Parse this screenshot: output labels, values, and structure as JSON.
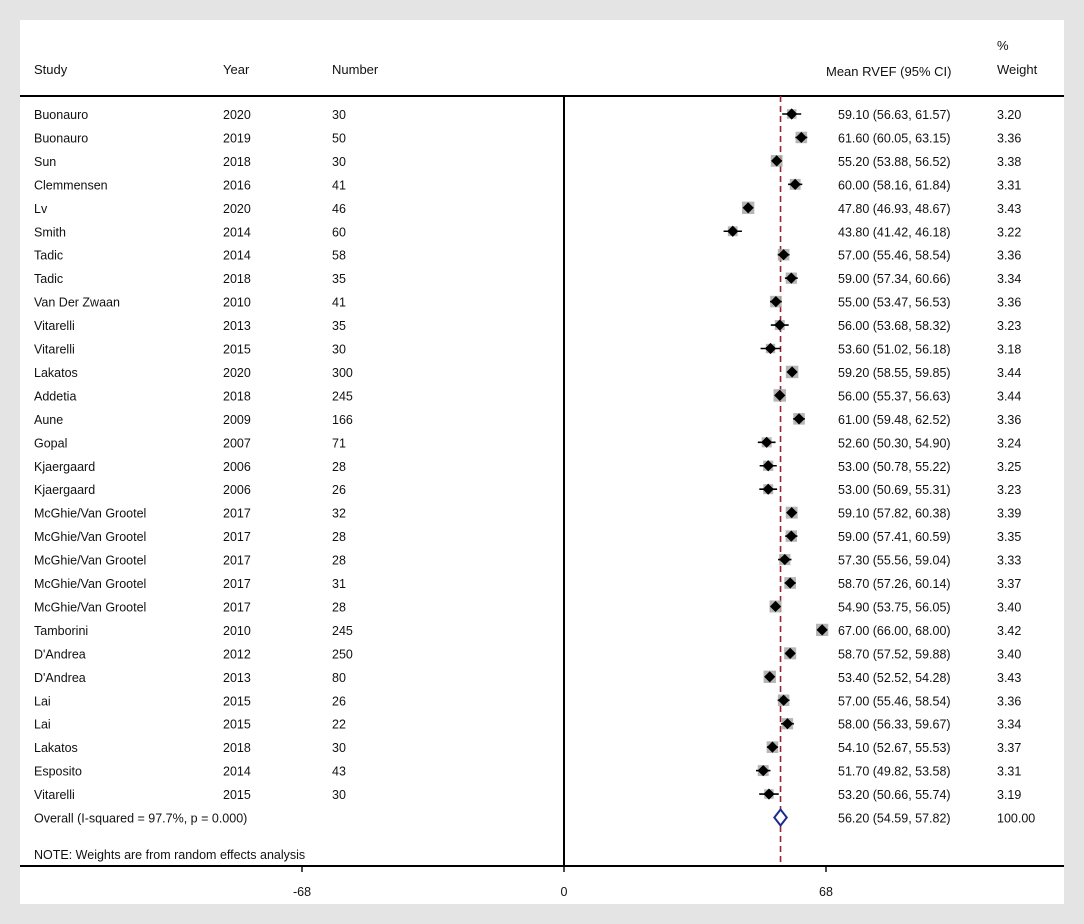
{
  "chart_data": {
    "type": "forest",
    "title": "",
    "headers": {
      "study": "Study",
      "year": "Year",
      "number": "Number",
      "estimate": "Mean RVEF (95% CI)",
      "weight_top": "%",
      "weight": "Weight"
    },
    "x_ticks": [
      "-68",
      "0",
      "68"
    ],
    "x_tick_values": [
      -68,
      0,
      68
    ],
    "xlim": [
      -145,
      130
    ],
    "reference_line": 0,
    "pooled_line": 56.2,
    "note": "NOTE: Weights are from random effects analysis",
    "studies": [
      {
        "study": "Buonauro",
        "year": "2020",
        "number": "30",
        "mean": 59.1,
        "lo": 56.63,
        "hi": 61.57,
        "ci_text": "59.10 (56.63, 61.57)",
        "weight": "3.20"
      },
      {
        "study": "Buonauro",
        "year": "2019",
        "number": "50",
        "mean": 61.6,
        "lo": 60.05,
        "hi": 63.15,
        "ci_text": "61.60 (60.05, 63.15)",
        "weight": "3.36"
      },
      {
        "study": "Sun",
        "year": "2018",
        "number": "30",
        "mean": 55.2,
        "lo": 53.88,
        "hi": 56.52,
        "ci_text": "55.20 (53.88, 56.52)",
        "weight": "3.38"
      },
      {
        "study": "Clemmensen",
        "year": "2016",
        "number": "41",
        "mean": 60.0,
        "lo": 58.16,
        "hi": 61.84,
        "ci_text": "60.00 (58.16, 61.84)",
        "weight": "3.31"
      },
      {
        "study": "Lv",
        "year": "2020",
        "number": "46",
        "mean": 47.8,
        "lo": 46.93,
        "hi": 48.67,
        "ci_text": "47.80 (46.93, 48.67)",
        "weight": "3.43"
      },
      {
        "study": "Smith",
        "year": "2014",
        "number": "60",
        "mean": 43.8,
        "lo": 41.42,
        "hi": 46.18,
        "ci_text": "43.80 (41.42, 46.18)",
        "weight": "3.22"
      },
      {
        "study": "Tadic",
        "year": "2014",
        "number": "58",
        "mean": 57.0,
        "lo": 55.46,
        "hi": 58.54,
        "ci_text": "57.00 (55.46, 58.54)",
        "weight": "3.36"
      },
      {
        "study": "Tadic",
        "year": "2018",
        "number": "35",
        "mean": 59.0,
        "lo": 57.34,
        "hi": 60.66,
        "ci_text": "59.00 (57.34, 60.66)",
        "weight": "3.34"
      },
      {
        "study": "Van Der Zwaan",
        "year": "2010",
        "number": "41",
        "mean": 55.0,
        "lo": 53.47,
        "hi": 56.53,
        "ci_text": "55.00 (53.47, 56.53)",
        "weight": "3.36"
      },
      {
        "study": "Vitarelli",
        "year": "2013",
        "number": "35",
        "mean": 56.0,
        "lo": 53.68,
        "hi": 58.32,
        "ci_text": "56.00 (53.68, 58.32)",
        "weight": "3.23"
      },
      {
        "study": "Vitarelli",
        "year": "2015",
        "number": "30",
        "mean": 53.6,
        "lo": 51.02,
        "hi": 56.18,
        "ci_text": "53.60 (51.02, 56.18)",
        "weight": "3.18"
      },
      {
        "study": "Lakatos",
        "year": "2020",
        "number": "300",
        "mean": 59.2,
        "lo": 58.55,
        "hi": 59.85,
        "ci_text": "59.20 (58.55, 59.85)",
        "weight": "3.44"
      },
      {
        "study": "Addetia",
        "year": "2018",
        "number": "245",
        "mean": 56.0,
        "lo": 55.37,
        "hi": 56.63,
        "ci_text": "56.00 (55.37, 56.63)",
        "weight": "3.44"
      },
      {
        "study": "Aune",
        "year": "2009",
        "number": "166",
        "mean": 61.0,
        "lo": 59.48,
        "hi": 62.52,
        "ci_text": "61.00 (59.48, 62.52)",
        "weight": "3.36"
      },
      {
        "study": "Gopal",
        "year": "2007",
        "number": "71",
        "mean": 52.6,
        "lo": 50.3,
        "hi": 54.9,
        "ci_text": "52.60 (50.30, 54.90)",
        "weight": "3.24"
      },
      {
        "study": "Kjaergaard",
        "year": "2006",
        "number": "28",
        "mean": 53.0,
        "lo": 50.78,
        "hi": 55.22,
        "ci_text": "53.00 (50.78, 55.22)",
        "weight": "3.25"
      },
      {
        "study": "Kjaergaard",
        "year": "2006",
        "number": "26",
        "mean": 53.0,
        "lo": 50.69,
        "hi": 55.31,
        "ci_text": "53.00 (50.69, 55.31)",
        "weight": "3.23"
      },
      {
        "study": "McGhie/Van Grootel",
        "year": "2017",
        "number": "32",
        "mean": 59.1,
        "lo": 57.82,
        "hi": 60.38,
        "ci_text": "59.10 (57.82, 60.38)",
        "weight": "3.39"
      },
      {
        "study": "McGhie/Van Grootel",
        "year": "2017",
        "number": "28",
        "mean": 59.0,
        "lo": 57.41,
        "hi": 60.59,
        "ci_text": "59.00 (57.41, 60.59)",
        "weight": "3.35"
      },
      {
        "study": "McGhie/Van Grootel",
        "year": "2017",
        "number": "28",
        "mean": 57.3,
        "lo": 55.56,
        "hi": 59.04,
        "ci_text": "57.30 (55.56, 59.04)",
        "weight": "3.33"
      },
      {
        "study": "McGhie/Van Grootel",
        "year": "2017",
        "number": "31",
        "mean": 58.7,
        "lo": 57.26,
        "hi": 60.14,
        "ci_text": "58.70 (57.26, 60.14)",
        "weight": "3.37"
      },
      {
        "study": "McGhie/Van Grootel",
        "year": "2017",
        "number": "28",
        "mean": 54.9,
        "lo": 53.75,
        "hi": 56.05,
        "ci_text": "54.90 (53.75, 56.05)",
        "weight": "3.40"
      },
      {
        "study": "Tamborini",
        "year": "2010",
        "number": "245",
        "mean": 67.0,
        "lo": 66.0,
        "hi": 68.0,
        "ci_text": "67.00 (66.00, 68.00)",
        "weight": "3.42"
      },
      {
        "study": "D'Andrea",
        "year": "2012",
        "number": "250",
        "mean": 58.7,
        "lo": 57.52,
        "hi": 59.88,
        "ci_text": "58.70 (57.52, 59.88)",
        "weight": "3.40"
      },
      {
        "study": "D'Andrea",
        "year": "2013",
        "number": "80",
        "mean": 53.4,
        "lo": 52.52,
        "hi": 54.28,
        "ci_text": "53.40 (52.52, 54.28)",
        "weight": "3.43"
      },
      {
        "study": "Lai",
        "year": "2015",
        "number": "26",
        "mean": 57.0,
        "lo": 55.46,
        "hi": 58.54,
        "ci_text": "57.00 (55.46, 58.54)",
        "weight": "3.36"
      },
      {
        "study": "Lai",
        "year": "2015",
        "number": "22",
        "mean": 58.0,
        "lo": 56.33,
        "hi": 59.67,
        "ci_text": "58.00 (56.33, 59.67)",
        "weight": "3.34"
      },
      {
        "study": "Lakatos",
        "year": "2018",
        "number": "30",
        "mean": 54.1,
        "lo": 52.67,
        "hi": 55.53,
        "ci_text": "54.10 (52.67, 55.53)",
        "weight": "3.37"
      },
      {
        "study": "Esposito",
        "year": "2014",
        "number": "43",
        "mean": 51.7,
        "lo": 49.82,
        "hi": 53.58,
        "ci_text": "51.70 (49.82, 53.58)",
        "weight": "3.31"
      },
      {
        "study": "Vitarelli",
        "year": "2015",
        "number": "30",
        "mean": 53.2,
        "lo": 50.66,
        "hi": 55.74,
        "ci_text": "53.20 (50.66, 55.74)",
        "weight": "3.19"
      }
    ],
    "overall": {
      "label": "Overall  (I-squared = 97.7%, p = 0.000)",
      "mean": 56.2,
      "lo": 54.59,
      "hi": 57.82,
      "ci_text": "56.20 (54.59, 57.82)",
      "weight": "100.00"
    },
    "colors": {
      "marker": "#000000",
      "weight_box": "#a9a9a9",
      "pooled_line": "#9a2333",
      "overall_diamond": "#1c2c8a",
      "axis": "#000000"
    }
  }
}
